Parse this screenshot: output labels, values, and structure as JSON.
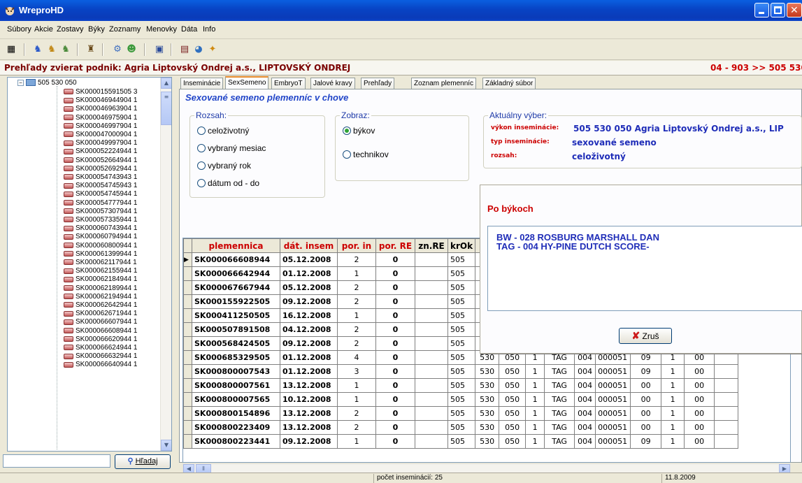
{
  "window": {
    "title": "WreproHD"
  },
  "menu": [
    "Súbory",
    "Akcie",
    "Zostavy",
    "Býky",
    "Zoznamy",
    "Menovky",
    "Dáta",
    "Info"
  ],
  "header": {
    "left": "Prehľady zvierat  podnik: Agria Liptovský Ondrej a.s., LIPTOVSKÝ ONDREJ",
    "right": "04 - 903  >>  505 530"
  },
  "tree": {
    "root": "505 530 050",
    "items": [
      "SK000015591505 3",
      "SK000046944904 1",
      "SK000046963904 1",
      "SK000046975904 1",
      "SK000046997904 1",
      "SK000047000904 1",
      "SK000049997904 1",
      "SK000052224944 1",
      "SK000052664944 1",
      "SK000052692944 1",
      "SK000054743943 1",
      "SK000054745943 1",
      "SK000054745944 1",
      "SK000054777944 1",
      "SK000057307944 1",
      "SK000057335944 1",
      "SK000060743944 1",
      "SK000060794944 1",
      "SK000060800944 1",
      "SK000061399944 1",
      "SK000062117944 1",
      "SK000062155944 1",
      "SK000062184944 1",
      "SK000062189944 1",
      "SK000062194944 1",
      "SK000062642944 1",
      "SK000062671944 1",
      "SK000066607944 1",
      "SK000066608944 1",
      "SK000066620944 1",
      "SK000066624944 1",
      "SK000066632944 1",
      "SK000066640944 1"
    ]
  },
  "search": {
    "button": "Hľadaj"
  },
  "tabs": [
    "Inseminácie",
    "SexSemeno",
    "EmbryoT",
    "Jalové kravy",
    "Prehľady",
    "Zoznam plemenníc",
    "Základný súbor"
  ],
  "section_title": "Sexované semeno plemenníc v chove",
  "rozsah": {
    "label": "Rozsah:",
    "options": [
      "celoživotný",
      "vybraný mesiac",
      "vybraný rok",
      "dátum od - do"
    ]
  },
  "zobraz": {
    "label": "Zobraz:",
    "options": [
      "býkov",
      "technikov"
    ]
  },
  "current": {
    "label": "Aktuálny výber:",
    "k1": "výkon inseminácie:",
    "v1": "505 530 050  Agria Liptovský Ondrej a.s., LIP",
    "k2": "typ inseminácie:",
    "v2": "sexované semeno",
    "k3": "rozsah:",
    "v3": "celoživotný"
  },
  "table": {
    "headers": [
      "plemennica",
      "dát. insem",
      "por. in",
      "por. RE",
      "zn.RE",
      "krOk"
    ],
    "rows": [
      [
        "SK000066608944",
        "05.12.2008",
        "2",
        "0",
        "",
        "505",
        "",
        "",
        "",
        "",
        "",
        "",
        "",
        "",
        ""
      ],
      [
        "SK000066642944",
        "01.12.2008",
        "1",
        "0",
        "",
        "505",
        "",
        "",
        "",
        "",
        "",
        "",
        "",
        "",
        ""
      ],
      [
        "SK000067667944",
        "05.12.2008",
        "2",
        "0",
        "",
        "505",
        "",
        "",
        "",
        "",
        "",
        "",
        "",
        "",
        ""
      ],
      [
        "SK000155922505",
        "09.12.2008",
        "2",
        "0",
        "",
        "505",
        "",
        "",
        "",
        "",
        "",
        "",
        "",
        "",
        ""
      ],
      [
        "SK000411250505",
        "16.12.2008",
        "1",
        "0",
        "",
        "505",
        "",
        "",
        "",
        "",
        "",
        "",
        "",
        "",
        ""
      ],
      [
        "SK000507891508",
        "04.12.2008",
        "2",
        "0",
        "",
        "505",
        "",
        "",
        "",
        "",
        "",
        "",
        "",
        "",
        ""
      ],
      [
        "SK000568424505",
        "09.12.2008",
        "2",
        "0",
        "",
        "505",
        "",
        "",
        "",
        "",
        "",
        "",
        "",
        "",
        ""
      ],
      [
        "SK000685329505",
        "01.12.2008",
        "4",
        "0",
        "",
        "505",
        "530",
        "050",
        "1",
        "TAG",
        "004",
        "000051",
        "09",
        "1",
        "00"
      ],
      [
        "SK000800007543",
        "01.12.2008",
        "3",
        "0",
        "",
        "505",
        "530",
        "050",
        "1",
        "TAG",
        "004",
        "000051",
        "09",
        "1",
        "00"
      ],
      [
        "SK000800007561",
        "13.12.2008",
        "1",
        "0",
        "",
        "505",
        "530",
        "050",
        "1",
        "TAG",
        "004",
        "000051",
        "00",
        "1",
        "00"
      ],
      [
        "SK000800007565",
        "10.12.2008",
        "1",
        "0",
        "",
        "505",
        "530",
        "050",
        "1",
        "TAG",
        "004",
        "000051",
        "00",
        "1",
        "00"
      ],
      [
        "SK000800154896",
        "13.12.2008",
        "2",
        "0",
        "",
        "505",
        "530",
        "050",
        "1",
        "TAG",
        "004",
        "000051",
        "00",
        "1",
        "00"
      ],
      [
        "SK000800223409",
        "13.12.2008",
        "2",
        "0",
        "",
        "505",
        "530",
        "050",
        "1",
        "TAG",
        "004",
        "000051",
        "00",
        "1",
        "00"
      ],
      [
        "SK000800223441",
        "09.12.2008",
        "1",
        "0",
        "",
        "505",
        "530",
        "050",
        "1",
        "TAG",
        "004",
        "000051",
        "09",
        "1",
        "00"
      ]
    ]
  },
  "popup": {
    "title": "Po býkoch",
    "lines": [
      "BW - 028   ROSBURG MARSHALL DAN",
      "TAG - 004   HY-PINE DUTCH SCORE-"
    ],
    "cancel": "Zruš"
  },
  "status": {
    "count": "počet inseminácií: 25",
    "date": "11.8.2009"
  }
}
